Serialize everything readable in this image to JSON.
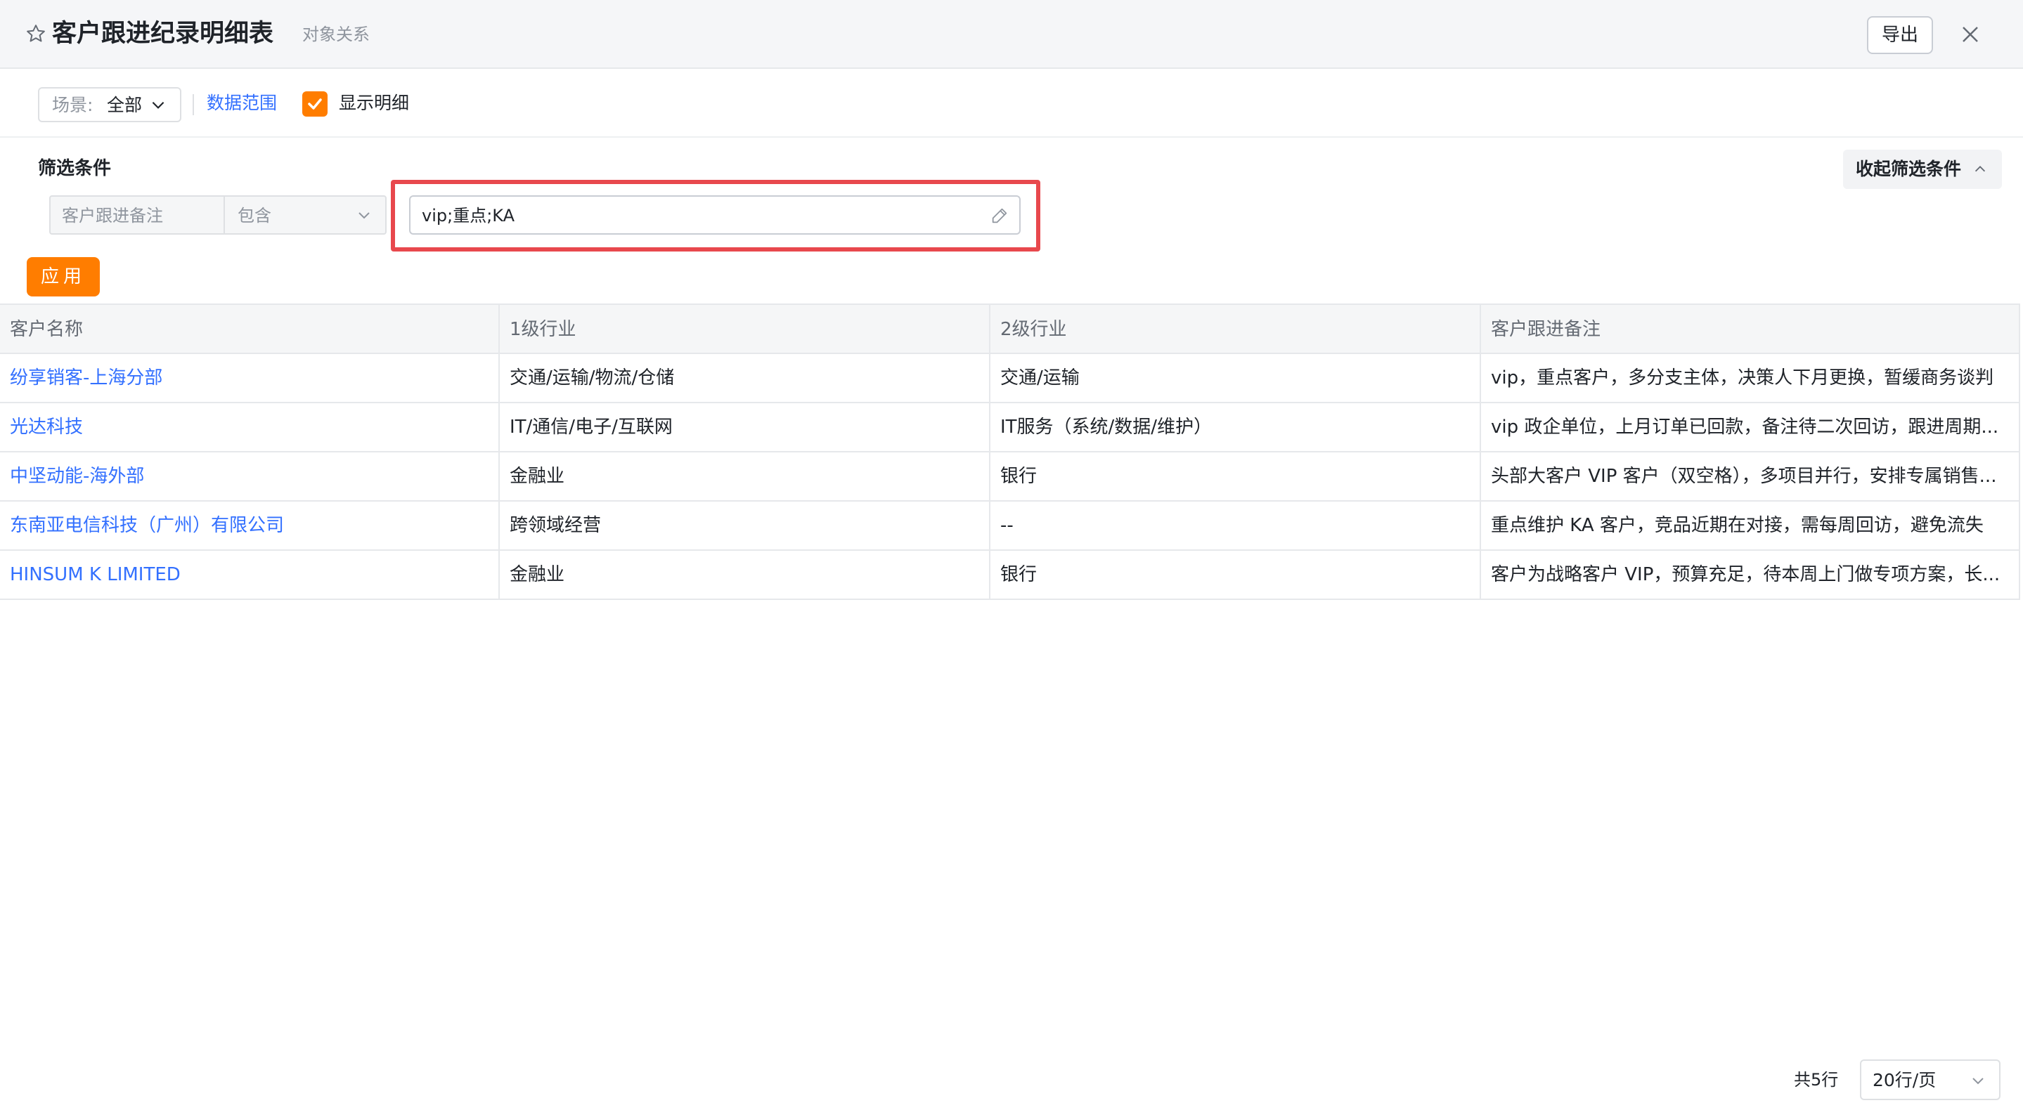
{
  "header": {
    "title": "客户跟进纪录明细表",
    "subtitle": "对象关系",
    "export_label": "导出"
  },
  "toolbar": {
    "scene_label": "场景:",
    "scene_value": "全部",
    "data_range_label": "数据范围",
    "show_detail_label": "显示明细",
    "show_detail_checked": true
  },
  "filter": {
    "title": "筛选条件",
    "collapse_label": "收起筛选条件",
    "field": "客户跟进备注",
    "operator": "包含",
    "value": "vip;重点;KA",
    "apply_label": "应用"
  },
  "table": {
    "columns": [
      "客户名称",
      "1级行业",
      "2级行业",
      "客户跟进备注"
    ],
    "rows": [
      [
        "纷享销客-上海分部",
        "交通/运输/物流/仓储",
        "交通/运输",
        "vip，重点客户，多分支主体，决策人下月更换，暂缓商务谈判"
      ],
      [
        "光达科技",
        "IT/通信/电子/互联网",
        "IT服务（系统/数据/维护）",
        "vip 政企单位，上月订单已回款，备注待二次回访，跟进周期..."
      ],
      [
        "中坚动能-海外部",
        "金融业",
        "银行",
        "头部大客户 VIP 客户（双空格），多项目并行，安排专属销售..."
      ],
      [
        "东南亚电信科技（广州）有限公司",
        "跨领域经营",
        "--",
        "重点维护 KA 客户，竞品近期在对接，需每周回访，避免流失"
      ],
      [
        "HINSUM K LIMITED",
        "金融业",
        "银行",
        "客户为战略客户 VIP，预算充足，待本周上门做专项方案，长..."
      ]
    ]
  },
  "footer": {
    "total": "共5行",
    "page_size": "20行/页"
  },
  "colors": {
    "accent": "#ff7d00",
    "link": "#3370ff",
    "highlight": "#e8484d"
  }
}
